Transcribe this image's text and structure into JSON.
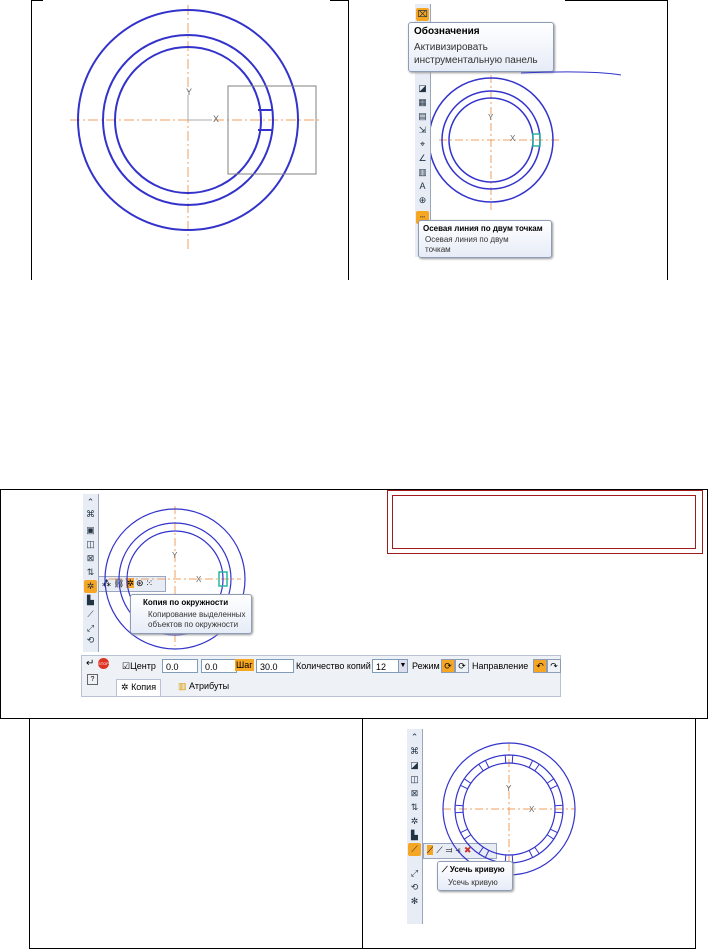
{
  "panel1": {
    "axis_x": "X",
    "axis_y": "Y"
  },
  "panel2": {
    "tooltip_title": "Обозначения",
    "tooltip_desc_1": "Активизировать",
    "tooltip_desc_2": "инструментальную панель",
    "tooltip2_title": "Осевая линия по двум точкам",
    "tooltip2_desc_1": "Осевая линия по двум",
    "tooltip2_desc_2": "точкам",
    "axis_x": "X",
    "axis_y": "Y"
  },
  "panel3": {
    "axis_x": "X",
    "axis_y": "Y",
    "tooltip_title": "Копия по окружности",
    "tooltip_desc_1": "Копирование выделенных",
    "tooltip_desc_2": "объектов по окружности",
    "stop_label": "STOP",
    "center_label": "Центр",
    "center_x": "0.0",
    "center_y": "0.0",
    "step_label": "Шаг",
    "step_value": "30.0",
    "copies_label": "Количество копий",
    "copies_value": "12",
    "mode_label": "Режим",
    "direction_label": "Направление",
    "tab_copy": "Копия",
    "tab_attributes": "Атрибуты"
  },
  "panel4": {
    "axis_x": "X",
    "axis_y": "Y",
    "tooltip_title": "Усечь кривую",
    "tooltip_desc": "Усечь кривую"
  },
  "colors": {
    "circle": "#3333cc",
    "axis": "#f0a060",
    "accent": "#f5a623",
    "tooltip_border": "#8e9db5",
    "frame_red": "#a01c1c"
  }
}
